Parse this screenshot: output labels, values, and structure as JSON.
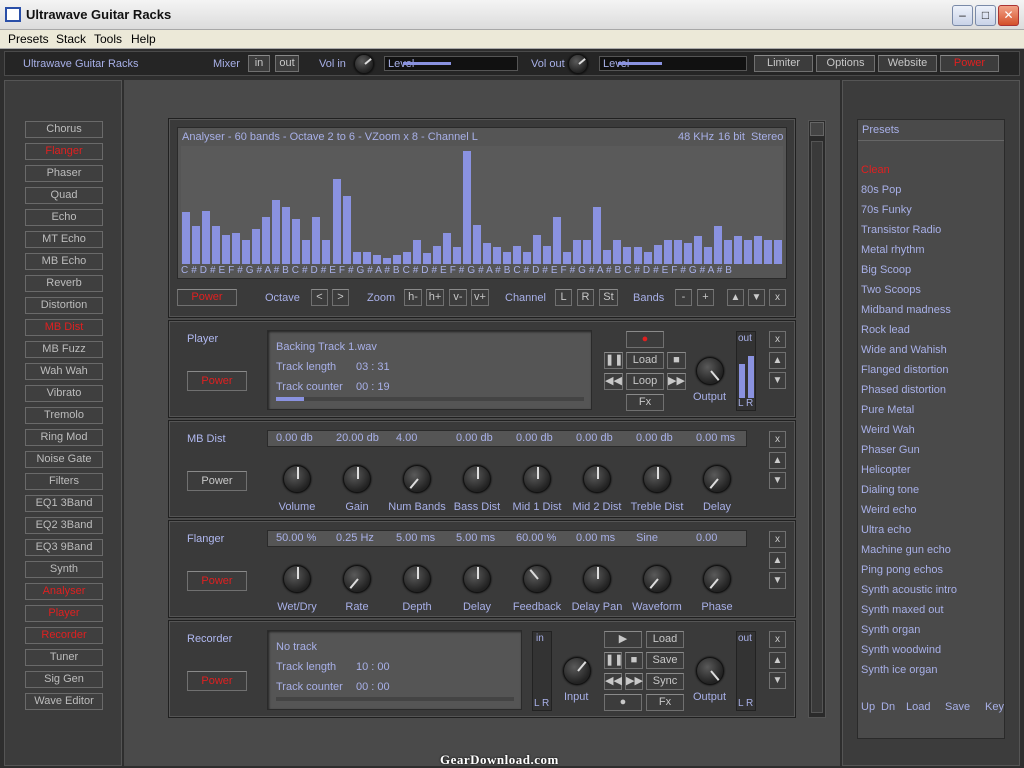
{
  "window": {
    "title": "Ultrawave Guitar Racks"
  },
  "menu": [
    "Presets",
    "Stack",
    "Tools",
    "Help"
  ],
  "topbar": {
    "brand": "Ultrawave Guitar Racks",
    "mixer": "Mixer",
    "in": "in",
    "out": "out",
    "vol_in": "Vol in",
    "level": "Level",
    "vol_out": "Vol out",
    "limiter": "Limiter",
    "options": "Options",
    "website": "Website",
    "power": "Power",
    "level_in": 0.6,
    "level_out": 0.55
  },
  "racks_list": [
    "Chorus",
    "Flanger",
    "Phaser",
    "Quad",
    "Echo",
    "MT Echo",
    "MB Echo",
    "Reverb",
    "Distortion",
    "MB Dist",
    "MB Fuzz",
    "Wah Wah",
    "Vibrato",
    "Tremolo",
    "Ring Mod",
    "Noise Gate",
    "Filters",
    "EQ1 3Band",
    "EQ2 3Band",
    "EQ3 9Band",
    "Synth",
    "Analyser",
    "Player",
    "Recorder",
    "Tuner",
    "Sig Gen",
    "Wave Editor"
  ],
  "racks_active": [
    1,
    9,
    21,
    22,
    23
  ],
  "analyser": {
    "title": "Analyser - 60 bands - Octave 2 to 6 - VZoom x 8 - Channel L",
    "rate": "48 KHz",
    "bits": "16 bit",
    "mode": "Stereo",
    "bands": [
      0.44,
      0.32,
      0.45,
      0.32,
      0.25,
      0.26,
      0.2,
      0.3,
      0.4,
      0.54,
      0.48,
      0.38,
      0.2,
      0.4,
      0.2,
      0.72,
      0.58,
      0.1,
      0.1,
      0.08,
      0.05,
      0.08,
      0.1,
      0.2,
      0.09,
      0.15,
      0.26,
      0.14,
      0.96,
      0.33,
      0.18,
      0.14,
      0.1,
      0.15,
      0.1,
      0.25,
      0.15,
      0.4,
      0.1,
      0.2,
      0.2,
      0.48,
      0.12,
      0.2,
      0.14,
      0.14,
      0.1,
      0.16,
      0.2,
      0.2,
      0.18,
      0.24,
      0.14,
      0.32,
      0.2,
      0.24,
      0.2,
      0.24,
      0.2,
      0.2
    ],
    "notes": "C # D # E F # G # A # B C # D # E F # G # A # B C # D # E F # G # A # B C # D # E F # G # A # B C # D # E F # G # A # B",
    "power": "Power",
    "octave": "Octave",
    "zoom": "Zoom",
    "channel": "Channel",
    "bands_label": "Bands",
    "octave_btns": [
      "<",
      ">"
    ],
    "zoom_btns": [
      "h-",
      "h+",
      "v-",
      "v+"
    ],
    "channel_btns": [
      "L",
      "R",
      "St"
    ],
    "band_btns": [
      "-",
      "+"
    ]
  },
  "player": {
    "name": "Player",
    "power": "Power",
    "track": "Backing Track 1.wav",
    "len_label": "Track length",
    "len": "03 : 31",
    "ctr_label": "Track counter",
    "ctr": "00 : 19",
    "load": "Load",
    "loop": "Loop",
    "fx": "Fx",
    "output": "Output",
    "out": "out",
    "lr": "L R",
    "progress": 0.09
  },
  "mbdist": {
    "name": "MB Dist",
    "power": "Power",
    "values": [
      "0.00 db",
      "20.00 db",
      "4.00",
      "0.00 db",
      "0.00 db",
      "0.00 db",
      "0.00 db",
      "0.00 ms"
    ],
    "knobs": [
      "Volume",
      "Gain",
      "Num Bands",
      "Bass Dist",
      "Mid 1 Dist",
      "Mid 2 Dist",
      "Treble Dist",
      "Delay"
    ]
  },
  "flanger": {
    "name": "Flanger",
    "power": "Power",
    "values": [
      "50.00 %",
      "0.25 Hz",
      "5.00 ms",
      "5.00 ms",
      "60.00 %",
      "0.00 ms",
      "Sine",
      "0.00"
    ],
    "knobs": [
      "Wet/Dry",
      "Rate",
      "Depth",
      "Delay",
      "Feedback",
      "Delay Pan",
      "Waveform",
      "Phase"
    ]
  },
  "recorder": {
    "name": "Recorder",
    "power": "Power",
    "track": "No track",
    "len_label": "Track length",
    "len": "10 : 00",
    "ctr_label": "Track counter",
    "ctr": "00 : 00",
    "in": "in",
    "out": "out",
    "lr": "L R",
    "input": "Input",
    "output": "Output",
    "load": "Load",
    "save": "Save",
    "sync": "Sync",
    "fx": "Fx"
  },
  "presets": {
    "title": "Presets",
    "items": [
      "Clean",
      "80s Pop",
      "70s Funky",
      "Transistor Radio",
      "Metal rhythm",
      "Big Scoop",
      "Two Scoops",
      "Midband madness",
      "Rock lead",
      "Wide and Wahish",
      "Flanged distortion",
      "Phased distortion",
      "Pure Metal",
      "Weird Wah",
      "Phaser Gun",
      "Helicopter",
      "Dialing tone",
      "Weird echo",
      "Ultra echo",
      "Machine gun echo",
      "Ping pong echos",
      "Synth acoustic intro",
      "Synth maxed out",
      "Synth organ",
      "Synth woodwind",
      "Synth ice organ"
    ],
    "active": 0,
    "footer": [
      "Up",
      "Dn",
      "Load",
      "Save",
      "Key"
    ]
  },
  "watermark": "GearDownload.com",
  "colors": {
    "accent": "#a8b0e8",
    "active": "#e02020",
    "bar": "#8a92e0"
  }
}
